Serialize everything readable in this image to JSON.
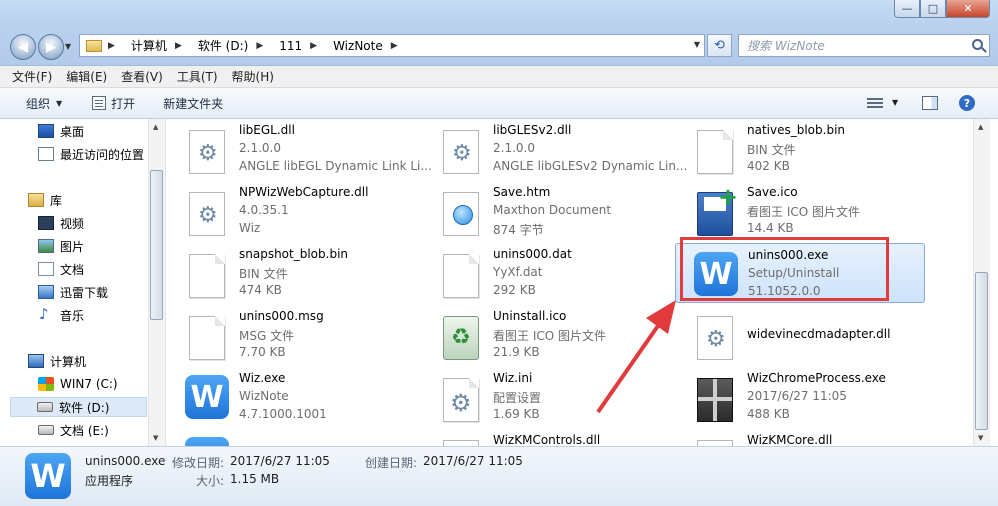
{
  "window": {
    "controls": {
      "minimize": "—",
      "maximize": "□",
      "close": "✕"
    }
  },
  "address": {
    "crumbs": [
      "计算机",
      "软件 (D:)",
      "111",
      "WizNote"
    ],
    "search_placeholder": "搜索 WizNote"
  },
  "menu": [
    "文件(F)",
    "编辑(E)",
    "查看(V)",
    "工具(T)",
    "帮助(H)"
  ],
  "commands": {
    "organize": "组织",
    "open": "打开",
    "new_folder": "新建文件夹",
    "help": "?"
  },
  "nav": {
    "items": [
      {
        "label": "桌面",
        "icon": "desktop-icon"
      },
      {
        "label": "最近访问的位置",
        "icon": "recent-places-icon"
      },
      {
        "label": "库",
        "icon": "library-icon"
      },
      {
        "label": "视频",
        "icon": "video-icon"
      },
      {
        "label": "图片",
        "icon": "picture-icon"
      },
      {
        "label": "文档",
        "icon": "document-icon"
      },
      {
        "label": "迅雷下载",
        "icon": "download-icon"
      },
      {
        "label": "音乐",
        "icon": "music-icon"
      },
      {
        "label": "计算机",
        "icon": "computer-icon"
      },
      {
        "label": "WIN7 (C:)",
        "icon": "drive-icon"
      },
      {
        "label": "软件 (D:)",
        "icon": "drive-icon",
        "selected": true
      },
      {
        "label": "文档 (E:)",
        "icon": "drive-icon"
      }
    ]
  },
  "files": [
    {
      "name": "libEGL.dll",
      "line2": "2.1.0.0",
      "line3": "ANGLE libEGL Dynamic Link Li...",
      "icon": "dll-icon"
    },
    {
      "name": "libGLESv2.dll",
      "line2": "2.1.0.0",
      "line3": "ANGLE libGLESv2 Dynamic Lin...",
      "icon": "dll-icon"
    },
    {
      "name": "natives_blob.bin",
      "line2": "BIN 文件",
      "line3": "402 KB",
      "icon": "blank-file-icon"
    },
    {
      "name": "NPWizWebCapture.dll",
      "line2": "4.0.35.1",
      "line3": "Wiz",
      "icon": "dll-icon"
    },
    {
      "name": "Save.htm",
      "line2": "Maxthon Document",
      "line3": "874 字节",
      "icon": "html-file-icon"
    },
    {
      "name": "Save.ico",
      "line2": "看图王 ICO 图片文件",
      "line3": "14.4 KB",
      "icon": "floppy-save-icon"
    },
    {
      "name": "snapshot_blob.bin",
      "line2": "BIN 文件",
      "line3": "474 KB",
      "icon": "blank-file-icon"
    },
    {
      "name": "unins000.dat",
      "line2": "YyXf.dat",
      "line3": "292 KB",
      "icon": "blank-file-icon"
    },
    {
      "name": "unins000.exe",
      "line2": "Setup/Uninstall",
      "line3": "51.1052.0.0",
      "icon": "wiznote-app-icon",
      "selected": true
    },
    {
      "name": "unins000.msg",
      "line2": "MSG 文件",
      "line3": "7.70 KB",
      "icon": "blank-file-icon"
    },
    {
      "name": "Uninstall.ico",
      "line2": "看图王 ICO 图片文件",
      "line3": "21.9 KB",
      "icon": "recycle-bin-icon"
    },
    {
      "name": "widevinecdmadapter.dll",
      "line2": "",
      "line3": "",
      "icon": "dll-icon"
    },
    {
      "name": "Wiz.exe",
      "line2": "WizNote",
      "line3": "4.7.1000.1001",
      "icon": "wiznote-app-icon"
    },
    {
      "name": "Wiz.ini",
      "line2": "配置设置",
      "line3": "1.69 KB",
      "icon": "settings-file-icon"
    },
    {
      "name": "WizChromeProcess.exe",
      "line2": "2017/6/27 11:05",
      "line3": "488 KB",
      "icon": "gift-box-icon"
    },
    {
      "name": "",
      "line2": "",
      "line3": "",
      "icon": "wiznote-app-icon"
    },
    {
      "name": "WizKMControls.dll",
      "line2": "",
      "line3": "",
      "icon": "dll-icon"
    },
    {
      "name": "WizKMCore.dll",
      "line2": "",
      "line3": "",
      "icon": "dll-icon"
    }
  ],
  "details": {
    "name": "unins000.exe",
    "type": "应用程序",
    "modified_label": "修改日期:",
    "modified_value": "2017/6/27 11:05",
    "created_label": "创建日期:",
    "created_value": "2017/6/27 11:05",
    "size_label": "大小:",
    "size_value": "1.15 MB",
    "icon_glyph": "W"
  },
  "colors": {
    "highlight_box": "#e23b3b",
    "selection": "#cde3fb",
    "wiz_blue": "#1f74d8"
  }
}
